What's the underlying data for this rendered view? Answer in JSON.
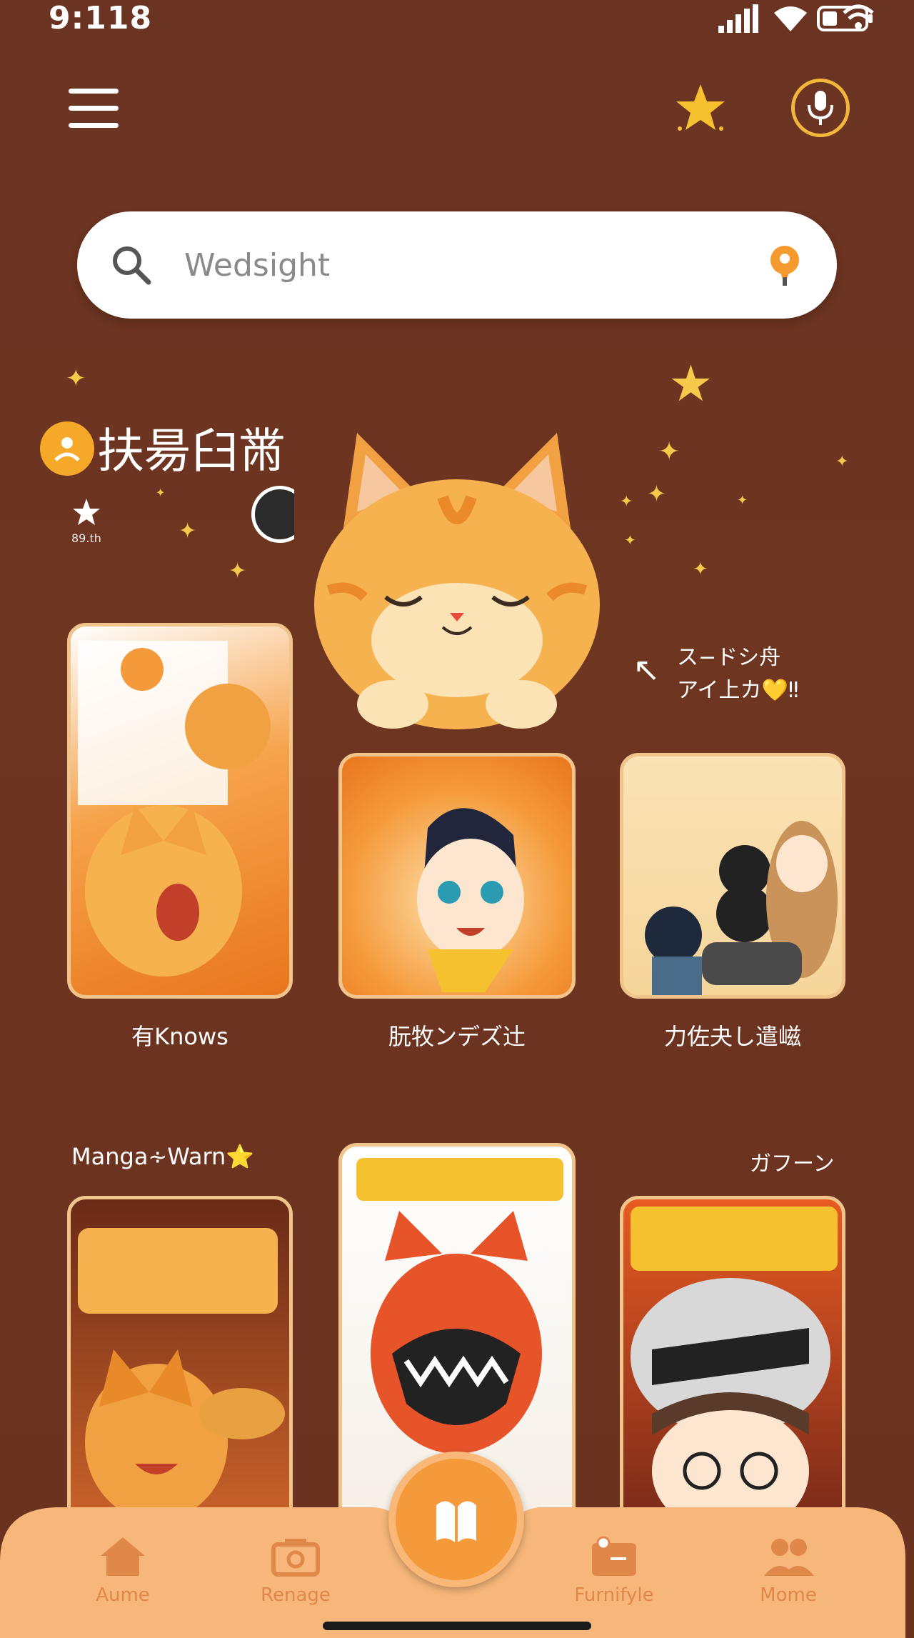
{
  "status_bar": {
    "time": "9:118"
  },
  "search": {
    "placeholder": "Wedsight"
  },
  "header": {
    "title": "扶昜臼黹",
    "star_count": "89.th"
  },
  "side_note": {
    "line1": "ス−ドシ舟",
    "line2": "アイ上カ💛‼"
  },
  "row1": [
    {
      "label": "有Knows"
    },
    {
      "label": "朊牧ンデズ辻"
    },
    {
      "label": "力佐夬し遣嵫"
    }
  ],
  "row2": {
    "left_label": "Manga∻Warn⭐",
    "right_label": "ガフーン"
  },
  "bottom_nav": {
    "items": [
      {
        "label": "Aume"
      },
      {
        "label": "Renage"
      },
      {
        "label": "Furnifyle"
      },
      {
        "label": "Mome"
      }
    ]
  },
  "colors": {
    "background": "#6b3422",
    "accent_orange": "#f59a3a",
    "star_yellow": "#f7c94b",
    "nav_bg": "#f7b77a",
    "nav_text": "#e0884a"
  }
}
